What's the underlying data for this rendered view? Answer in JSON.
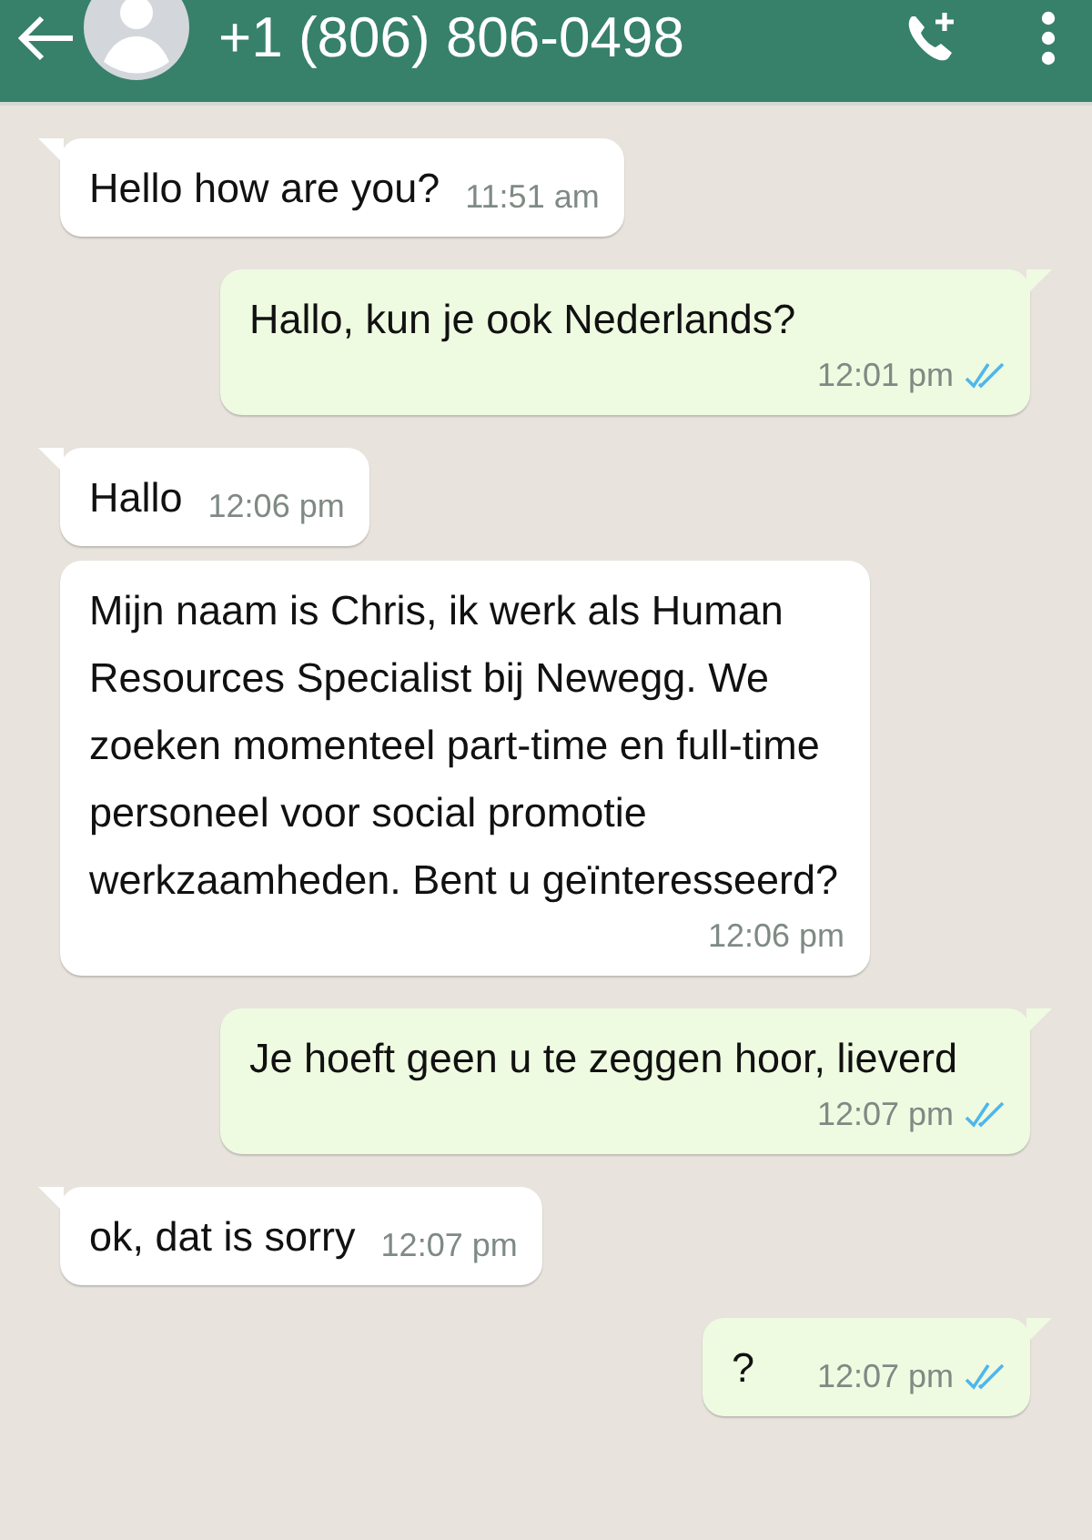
{
  "header": {
    "title": "+1 (806) 806-0498"
  },
  "messages": [
    {
      "kind": "incoming",
      "text": "Hello how are you?",
      "time": "11:51 am",
      "tail": true
    },
    {
      "kind": "outgoing",
      "text": "Hallo, kun je ook Nederlands?",
      "time": "12:01 pm",
      "tail": true,
      "read": true
    },
    {
      "kind": "incoming",
      "text": "Hallo",
      "time": "12:06 pm",
      "tail": true
    },
    {
      "kind": "incoming",
      "text": "Mijn naam is Chris, ik werk als Human Resources Specialist bij Newegg. We zoeken momenteel part-time en full-time personeel voor social promotie werkzaamheden. Bent u geïnteresseerd?",
      "time": "12:06 pm",
      "tail": false
    },
    {
      "kind": "outgoing",
      "text": "Je hoeft geen u te zeggen hoor, lieverd",
      "time": "12:07 pm",
      "tail": true,
      "read": true
    },
    {
      "kind": "incoming",
      "text": "ok, dat is sorry",
      "time": "12:07 pm",
      "tail": true
    },
    {
      "kind": "outgoing",
      "text": "?",
      "time": "12:07 pm",
      "tail": true,
      "read": true
    }
  ]
}
